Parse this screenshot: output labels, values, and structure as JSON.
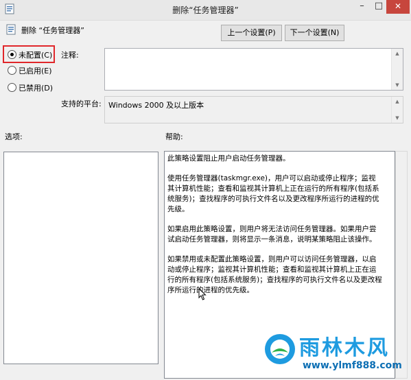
{
  "window": {
    "title": "删除“任务管理器”",
    "min_symbol": "–",
    "max_symbol": "□",
    "close_symbol": "✕"
  },
  "header": {
    "policy_title": "删除 “任务管理器”",
    "prev_label": "上一个设置(P)",
    "next_label": "下一个设置(N)"
  },
  "state": {
    "options": [
      "未配置(C)",
      "已启用(E)",
      "已禁用(D)"
    ],
    "selected_index": 0
  },
  "labels": {
    "comment": "注释:",
    "platform": "支持的平台:",
    "options": "选项:",
    "help": "帮助:"
  },
  "platform_value": "Windows 2000 及以上版本",
  "help_paragraphs": [
    "此策略设置阻止用户启动任务管理器。",
    "使用任务管理器(taskmgr.exe)，用户可以启动或停止程序；监视其计算机性能；查看和监视其计算机上正在运行的所有程序(包括系统服务)；查找程序的可执行文件名以及更改程序所运行的进程的优先级。",
    "如果启用此策略设置，则用户将无法访问任务管理器。如果用户尝试启动任务管理器，则将显示一条消息，说明某策略阻止该操作。",
    "如果禁用或未配置此策略设置，则用户可以访问任务管理器，以启动或停止程序；监视其计算机性能；查看和监视其计算机上正在运行的所有程序(包括系统服务)；查找程序的可执行文件名以及更改程序所运行的进程的优先级。"
  ],
  "watermark": {
    "text": "雨林木风",
    "url": "www.ylmf888.com"
  },
  "colors": {
    "highlight_border": "#e0262a",
    "watermark_blue": "#1e9be0",
    "close_red": "#c7463d"
  }
}
